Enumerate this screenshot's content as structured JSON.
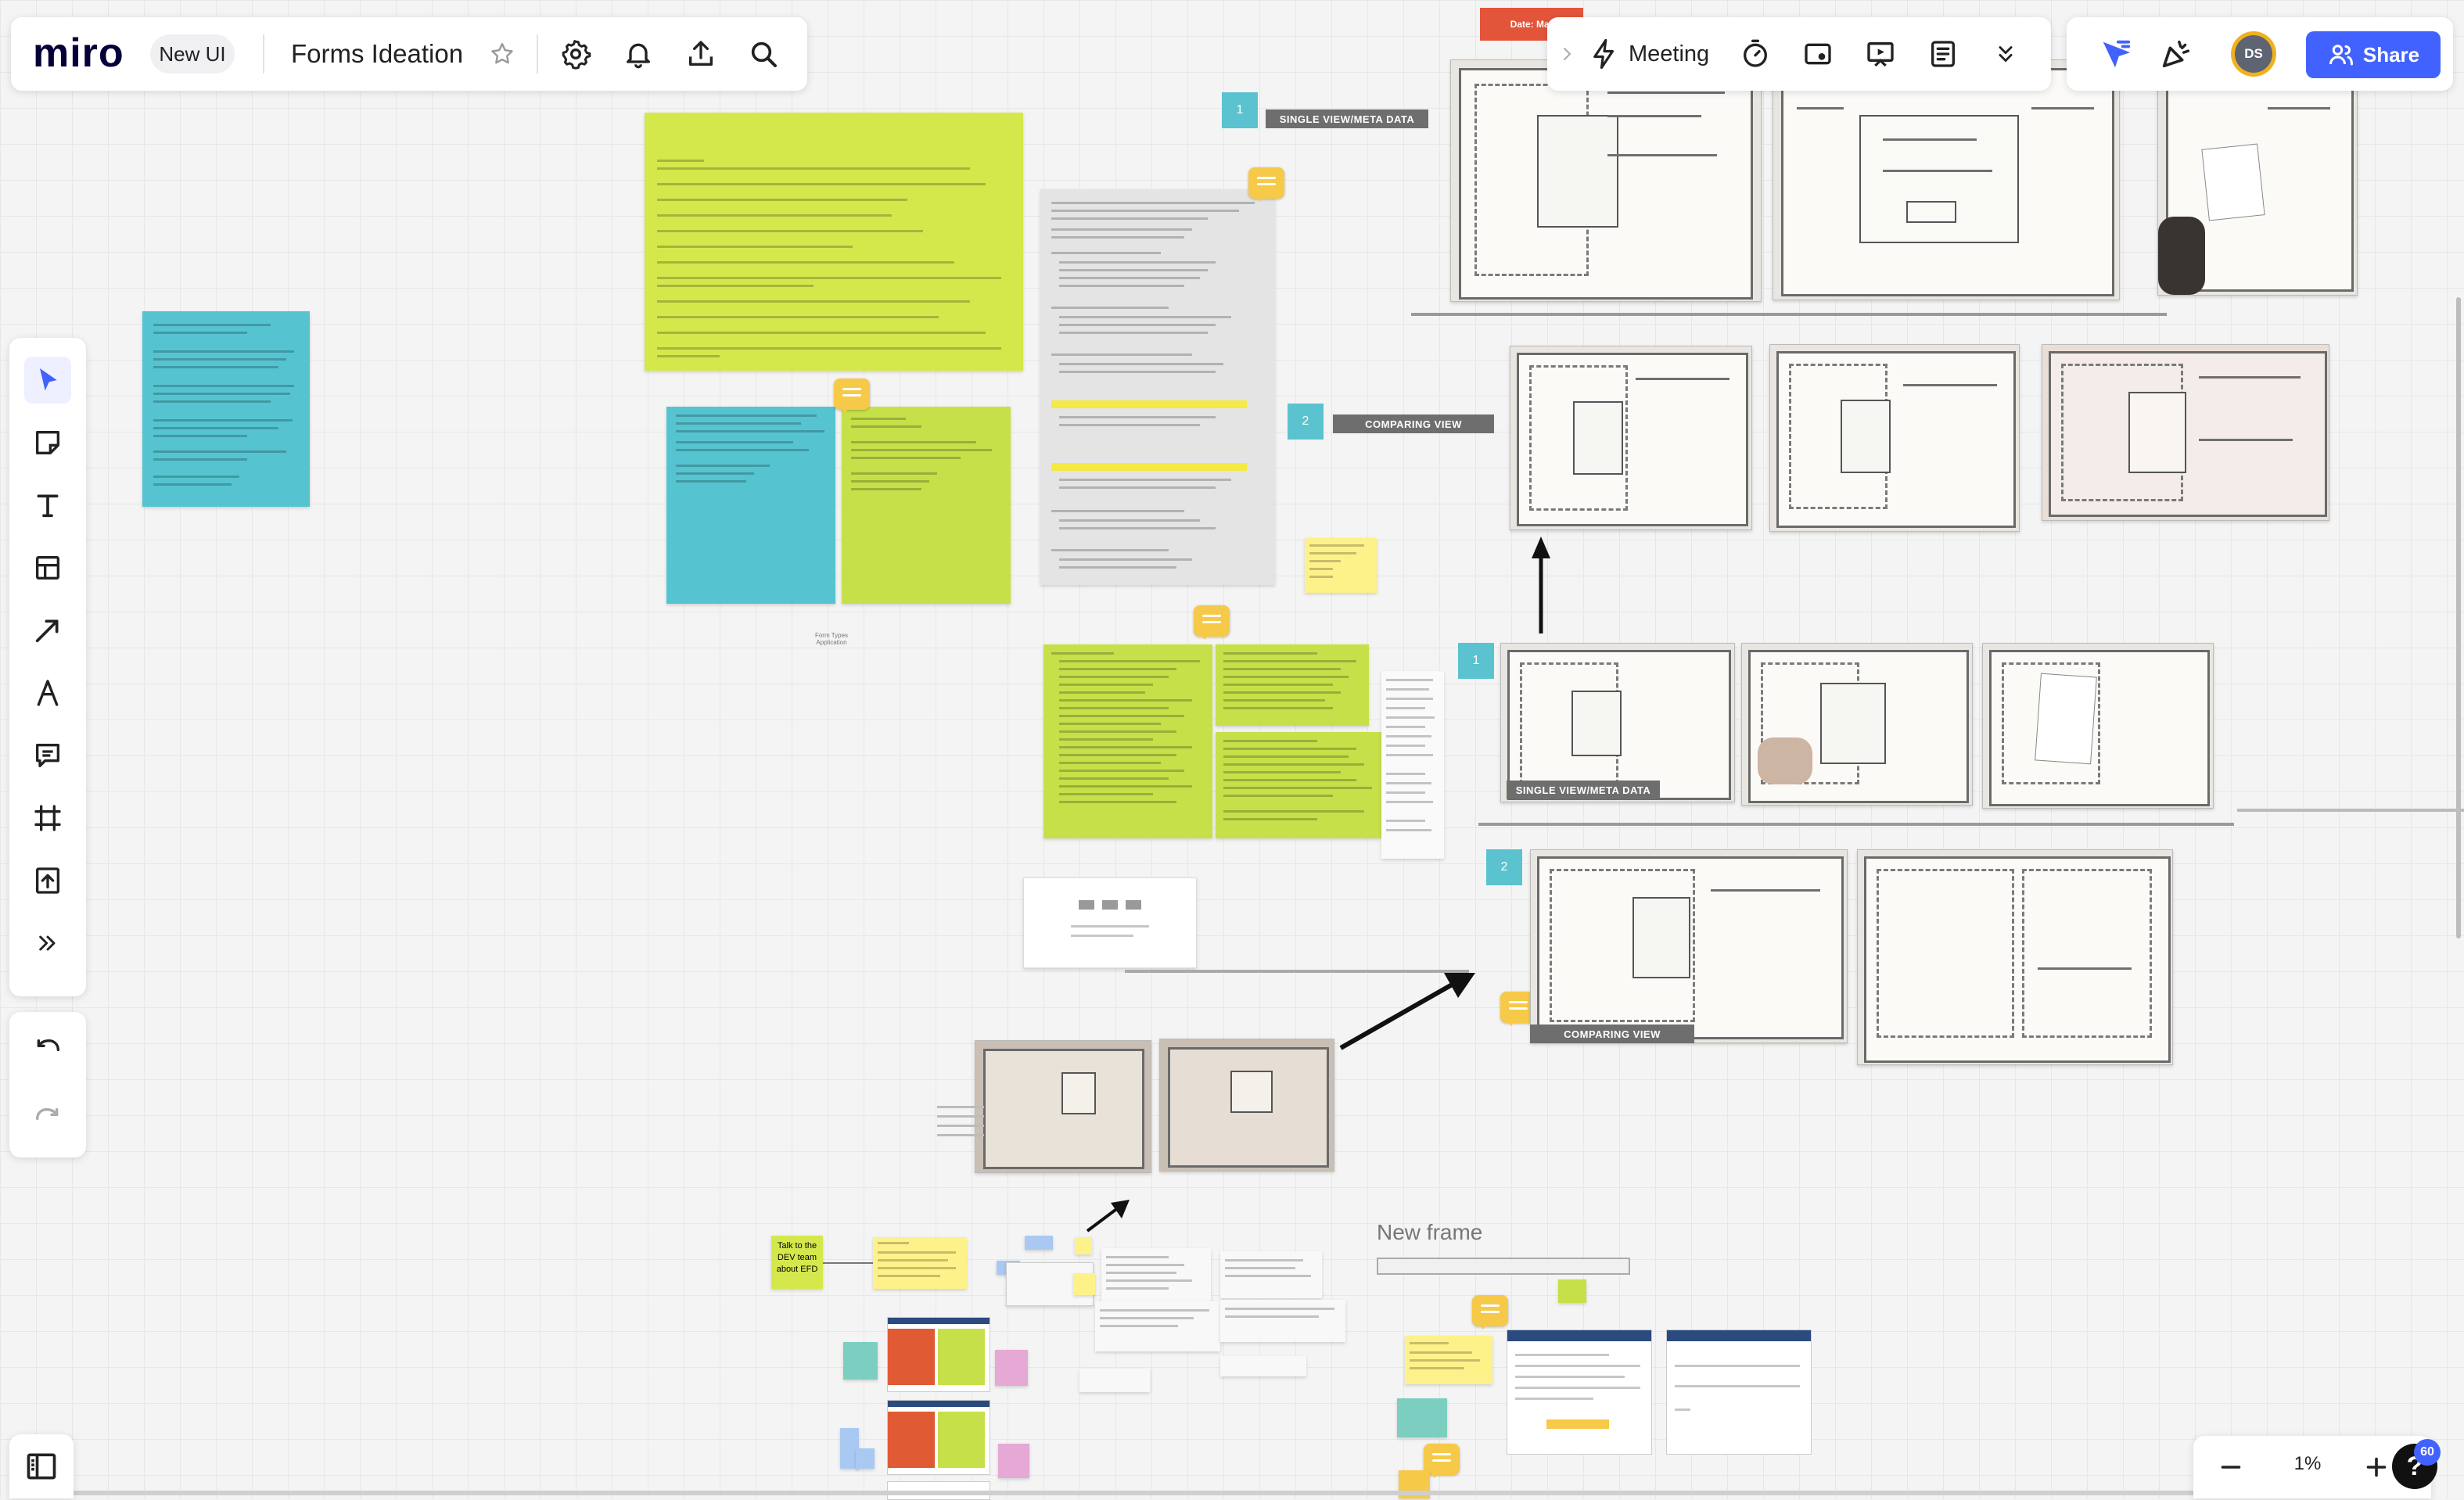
{
  "header": {
    "logo": "miro",
    "ui_badge": "New UI",
    "board_title": "Forms Ideation",
    "date_tag": "Date: Mar"
  },
  "toolbar_right": {
    "meeting_label": "Meeting",
    "avatar_initials": "DS",
    "share_label": "Share"
  },
  "canvas": {
    "frame_label": "New frame",
    "talk_sticky": "Talk to the DEV team about EFD",
    "labels": {
      "single_view": "SINGLE VIEW/META DATA",
      "comparing_view": "COMPARING VIEW",
      "single_view_2": "SINGLE VIEW/META DATA",
      "comparing_view_2": "COMPARING VIEW"
    },
    "badges": [
      "1",
      "2",
      "1",
      "2"
    ],
    "form_types_note": "Form Types Application"
  },
  "bottom": {
    "zoom_level": "1%",
    "help_badge": "60"
  },
  "icons": [
    "select-icon",
    "sticky-note-icon",
    "text-icon",
    "template-icon",
    "arrow-line-icon",
    "pen-icon",
    "comment-icon",
    "frame-icon",
    "upload-icon",
    "more-tools-icon",
    "undo-icon",
    "redo-icon",
    "settings-icon",
    "bell-icon",
    "export-icon",
    "search-icon",
    "star-icon",
    "lightning-icon",
    "timer-icon",
    "card-icon",
    "present-icon",
    "notes-icon",
    "chevron-down-icon",
    "cursor-icon",
    "reactions-icon",
    "users-icon",
    "panel-icon",
    "zoom-out-icon",
    "zoom-in-icon",
    "help-icon"
  ],
  "colors": {
    "accent": "#4262ff",
    "sticky_yellow_green": "#d4e84c",
    "sticky_teal": "#55c4d0",
    "sticky_green": "#c6e04a",
    "sticky_yellow": "#fdf28a",
    "comment": "#f7c948",
    "date_tag": "#e2553b"
  }
}
